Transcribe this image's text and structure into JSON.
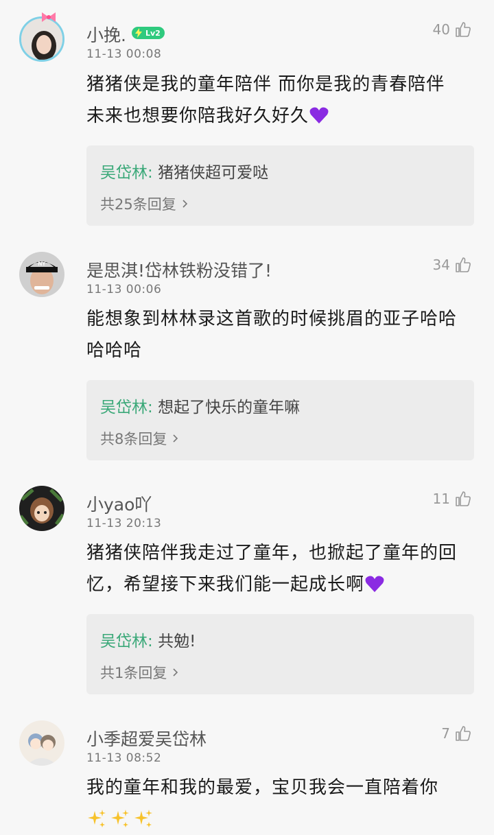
{
  "comments": [
    {
      "username": "小挽.",
      "level_badge": "Lv2",
      "time": "11-13 00:08",
      "likes": "40",
      "text_line1": "猪猪侠是我的童年陪伴 而你是我的青春陪伴",
      "text_line2": "未来也想要你陪我好久好久",
      "reply_author": "吴岱林:",
      "reply_text": "猪猪侠超可爱哒",
      "reply_count": "共25条回复"
    },
    {
      "username": "是思淇!岱林铁粉没错了!",
      "time": "11-13 00:06",
      "likes": "34",
      "text_line1": "能想象到林林录这首歌的时候挑眉的亚子哈哈",
      "text_line2": "哈哈哈",
      "reply_author": "吴岱林:",
      "reply_text": "想起了快乐的童年嘛",
      "reply_count": "共8条回复"
    },
    {
      "username": "小yao吖",
      "time": "11-13 20:13",
      "likes": "11",
      "text_line1": "猪猪侠陪伴我走过了童年，也掀起了童年的回",
      "text_line2": "忆，希望接下来我们能一起成长啊",
      "reply_author": "吴岱林:",
      "reply_text": "共勉!",
      "reply_count": "共1条回复"
    },
    {
      "username": "小季超爱吴岱林",
      "time": "11-13 08:52",
      "likes": "7",
      "text_line1": "我的童年和我的最爱，宝贝我会一直陪着你"
    }
  ],
  "colors": {
    "background": "#f7f7f7",
    "reply_author": "#3aa878",
    "badge": "#2fca7e",
    "heart": "#8a2be2"
  }
}
